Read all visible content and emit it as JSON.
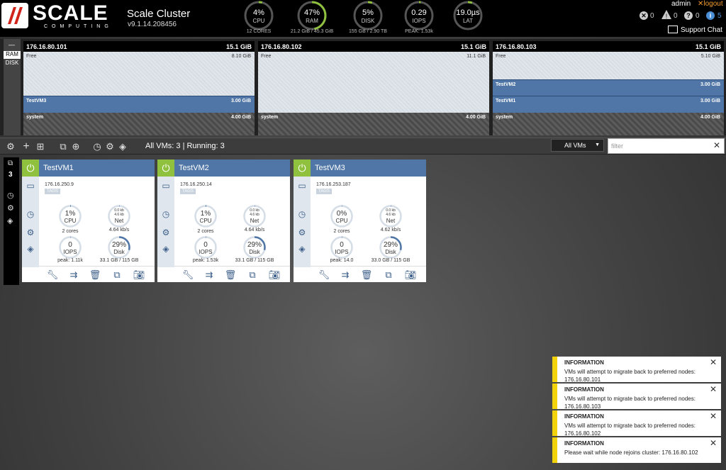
{
  "header": {
    "logo_text": "SCALE",
    "logo_sub": "COMPUTING",
    "cluster_name": "Scale Cluster",
    "version": "v9.1.14.208456",
    "gauges": [
      {
        "id": "cpu",
        "value": "4%",
        "label": "CPU",
        "sub": "12 CORES",
        "level": 0.04
      },
      {
        "id": "ram",
        "value": "47%",
        "label": "RAM",
        "sub": "21.2 GiB / 45.3 GiB",
        "level": 0.47
      },
      {
        "id": "disk",
        "value": "5%",
        "label": "DISK",
        "sub": "155 GB / 2.90 TB",
        "level": 0.05
      },
      {
        "id": "iops",
        "value": "0.29",
        "label": "IOPS",
        "sub": "PEAK: 1.53k",
        "level": 0.02
      },
      {
        "id": "lat",
        "value": "19.0µs",
        "label": "LAT",
        "sub": "",
        "level": 0.05
      }
    ],
    "user": "admin",
    "logout": "logout",
    "support": "Support Chat",
    "alerts": {
      "errors": "0",
      "warnings": "0",
      "questions": "0",
      "info": "5"
    },
    "colors": {
      "gauge_track": "#555555",
      "gauge_fill": "#8fc13f",
      "info": "#4a8fd6"
    }
  },
  "resource": {
    "tabs": {
      "collapse": "—",
      "ram": "RAM",
      "disk": "DISK"
    },
    "nodes": [
      {
        "ip": "176.16.80.101",
        "total": "15.1 GiB",
        "segments": [
          {
            "kind": "free",
            "name": "Free",
            "size": "8.10 GiB"
          },
          {
            "kind": "vm",
            "name": "TestVM3",
            "size": "3.00 GiB"
          },
          {
            "kind": "system",
            "name": "system",
            "size": "4.00 GiB"
          }
        ]
      },
      {
        "ip": "176.16.80.102",
        "total": "15.1 GiB",
        "segments": [
          {
            "kind": "free",
            "name": "Free",
            "size": "11.1 GiB"
          },
          {
            "kind": "system",
            "name": "system",
            "size": "4.00 GiB"
          }
        ]
      },
      {
        "ip": "176.16.80.103",
        "total": "15.1 GiB",
        "segments": [
          {
            "kind": "free",
            "name": "Free",
            "size": "5.10 GiB"
          },
          {
            "kind": "vm",
            "name": "TestVM2",
            "size": "3.00 GiB"
          },
          {
            "kind": "vm",
            "name": "TestVM1",
            "size": "3.00 GiB"
          },
          {
            "kind": "system",
            "name": "system",
            "size": "4.00 GiB"
          }
        ]
      }
    ]
  },
  "toolbar": {
    "summary": "All VMs: 3 | Running: 3",
    "select_value": "All VMs",
    "filter_placeholder": "filter"
  },
  "rail": {
    "count": "3"
  },
  "vms": [
    {
      "name": "TestVM1",
      "ip": "176.16.250.9",
      "tags": "TAGS",
      "cpu": "1%",
      "cpu_label": "CPU",
      "cores": "2 cores",
      "cpu_level": 0.01,
      "net_tx": "0.0 kb",
      "net_rx": "4.6 kb",
      "net_label": "Net",
      "net_rate": "4.64 kb/s",
      "iops": "0",
      "iops_label": "IOPS",
      "iops_peak": "peak: 1.11k",
      "disk": "29%",
      "disk_label": "Disk",
      "disk_usage": "33.1 GB / 115 GB",
      "disk_level": 0.29
    },
    {
      "name": "TestVM2",
      "ip": "176.16.250.14",
      "tags": "TAGS",
      "cpu": "1%",
      "cpu_label": "CPU",
      "cores": "2 cores",
      "cpu_level": 0.01,
      "net_tx": "0.0 kb",
      "net_rx": "4.6 kb",
      "net_label": "Net",
      "net_rate": "4.64 kb/s",
      "iops": "0",
      "iops_label": "IOPS",
      "iops_peak": "peak: 1.53k",
      "disk": "29%",
      "disk_label": "Disk",
      "disk_usage": "33.1 GB / 115 GB",
      "disk_level": 0.29
    },
    {
      "name": "TestVM3",
      "ip": "176.16.253.187",
      "tags": "TAGS",
      "cpu": "0%",
      "cpu_label": "CPU",
      "cores": "2 cores",
      "cpu_level": 0.0,
      "net_tx": "0.0 kb",
      "net_rx": "4.6 kb",
      "net_label": "Net",
      "net_rate": "4.62 kb/s",
      "iops": "0",
      "iops_label": "IOPS",
      "iops_peak": "peak: 14.0",
      "disk": "29%",
      "disk_label": "Disk",
      "disk_usage": "33.0 GB / 115 GB",
      "disk_level": 0.29
    }
  ],
  "notifications": [
    {
      "title": "INFORMATION",
      "body": "VMs will attempt to migrate back to preferred nodes: 176.16.80.101"
    },
    {
      "title": "INFORMATION",
      "body": "VMs will attempt to migrate back to preferred nodes: 176.16.80.103"
    },
    {
      "title": "INFORMATION",
      "body": "VMs will attempt to migrate back to preferred nodes: 176.16.80.102"
    },
    {
      "title": "INFORMATION",
      "body": "Please wait while node rejoins cluster: 176.16.80.102"
    }
  ]
}
